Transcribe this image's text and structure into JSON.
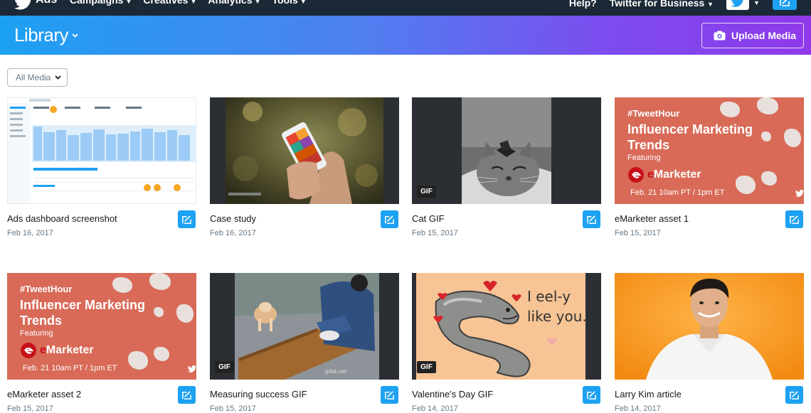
{
  "topnav": {
    "brand": "Ads",
    "menu": [
      "Campaigns",
      "Creatives",
      "Analytics",
      "Tools"
    ],
    "help": "Help?",
    "account": "Twitter for Business"
  },
  "header": {
    "title": "Library",
    "upload_label": "Upload Media"
  },
  "filter": {
    "label": "All Media"
  },
  "media": [
    {
      "name": "Ads dashboard screenshot",
      "date": "Feb 16, 2017"
    },
    {
      "name": "Case study",
      "date": "Feb 16, 2017"
    },
    {
      "name": "Cat GIF",
      "date": "Feb 15, 2017",
      "badge": "GIF"
    },
    {
      "name": "eMarketer asset 1",
      "date": "Feb 15, 2017"
    },
    {
      "name": "eMarketer asset 2",
      "date": "Feb 15, 2017"
    },
    {
      "name": "Measuring success GIF",
      "date": "Feb 15, 2017",
      "badge": "GIF"
    },
    {
      "name": "Valentine's Day GIF",
      "date": "Feb 14, 2017",
      "badge": "GIF"
    },
    {
      "name": "Larry Kim article",
      "date": "Feb 14, 2017"
    }
  ],
  "promo": {
    "hashtag": "#TweetHour",
    "headline": "Influencer Marketing Trends",
    "featuring": "Featuring",
    "brand": "Marketer",
    "brand_e": "e",
    "when": "Feb. 21 10am PT / 1pm ET"
  },
  "valentine": {
    "line1": "I eel-y",
    "line2": "like you."
  },
  "gif_watermark": "gifak.net",
  "colors": {
    "twitter_blue": "#1da1f2",
    "nav_dark": "#1b2836",
    "promo_red": "#d86a57"
  }
}
